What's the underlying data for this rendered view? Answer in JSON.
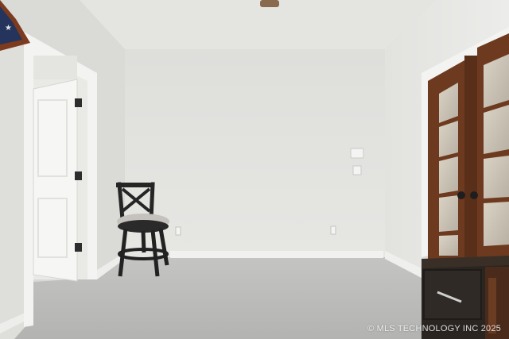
{
  "scene": {
    "description_type": "interior room photograph",
    "colors": {
      "wall": "#e2e2df",
      "ceiling": "#e6e6e3",
      "carpet": "#b9b9b7",
      "trim": "#f4f4f2",
      "wood_door": "#7a4426",
      "stool": "#262626",
      "cabinet": "#2b2622"
    }
  },
  "watermark": {
    "text": "© MLS TECHNOLOGY INC 2025"
  }
}
